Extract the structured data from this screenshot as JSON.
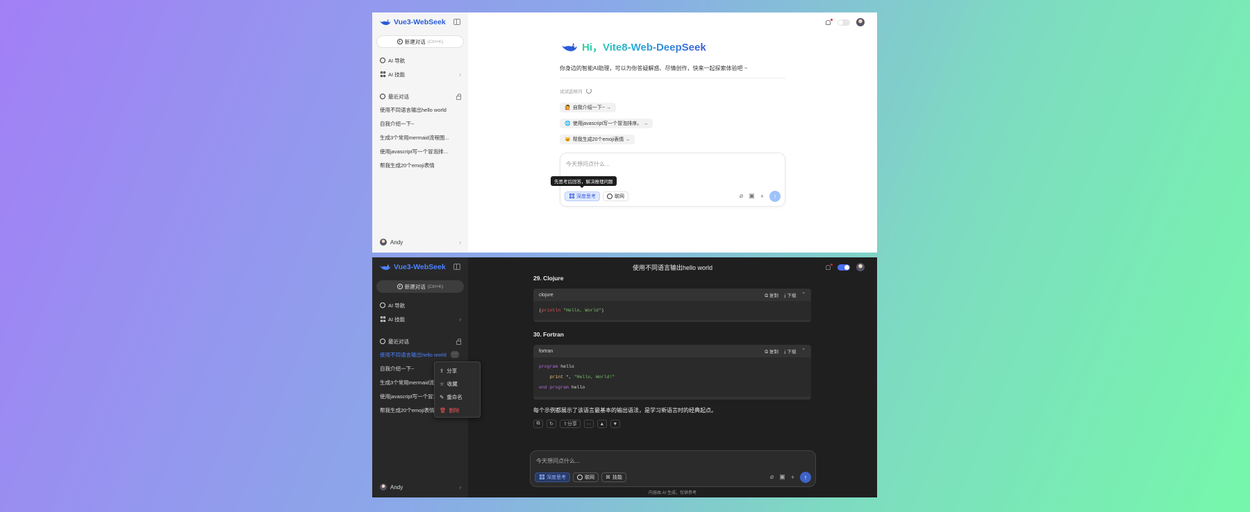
{
  "app": {
    "name": "Vue3-WebSeek",
    "user": "Andy"
  },
  "colors": {
    "accent": "#4c82ff",
    "brand_blue": "#2a5bd7",
    "danger": "#ef5454",
    "send_light": "#9ec2fa",
    "send_dark": "#3e63c8"
  },
  "icons": {
    "logo": "whale-logo-icon",
    "collapse": "sidebar-toggle-icon",
    "new_chat": "plus-circle-icon",
    "ai_nav": "compass-icon",
    "ai_skills": "grid-icon",
    "recent": "chat-bubble-icon",
    "clear_history": "lock-icon",
    "notifications": "bell-icon",
    "theme": "toggle-switch-icon",
    "attach": "paperclip-icon",
    "image": "image-icon",
    "add": "plus-icon",
    "send": "arrow-up-icon"
  },
  "sidebar": {
    "new_chat": "新建对话",
    "new_chat_hint": "(Ctrl+K)",
    "ai_nav": "AI 导航",
    "ai_skills": "AI 技能",
    "recent_title": "最近对话",
    "recent": [
      "使用不同语言输出hello world",
      "自我介绍一下~",
      "生成3个常用mermaid流程图...",
      "使用javascript写一个冒泡排...",
      "帮我生成20个emoji表情"
    ],
    "recent_dark": [
      "使用不同语言输出hello world",
      "自我介绍一下~",
      "生成3个常用mermaid流程",
      "使用javascript写一个冒泡",
      "帮我生成20个emoji表情"
    ]
  },
  "light": {
    "greeting": "Hi，Vite8-Web-DeepSeek",
    "subtitle": "你身边的智能AI助理，可以为你答疑解惑、尽情创作，快来一起探索体验吧 ~",
    "try_label": "试试这样问",
    "suggestions": [
      {
        "emoji": "🙋",
        "text": "自我介绍一下~ →"
      },
      {
        "emoji": "🌐",
        "text": "使用javascript写一个冒泡排序。 →"
      },
      {
        "emoji": "🐱",
        "text": "帮我生成20个emoji表情 →"
      }
    ],
    "placeholder": "今天想问点什么...",
    "tooltip": "先思考后回答，解决推理问题",
    "deep_think": "深度思考",
    "web": "联网"
  },
  "dark": {
    "chat_title": "使用不同语言输出hello world",
    "sections": [
      {
        "title": "29. Clojure",
        "lang": "clojure"
      },
      {
        "title": "30. Fortran",
        "lang": "fortran"
      }
    ],
    "copy": "复制",
    "download": "下载",
    "code_clojure": {
      "open": "(",
      "fn": "println",
      "str": " \"Hello, World\"",
      "close": ")"
    },
    "code_fortran": {
      "kw1": "program",
      "name1": " hello",
      "kw2": "print",
      "mid": " *, ",
      "str": "\"Hello, World!\"",
      "kw3": "end program",
      "name3": " hello"
    },
    "summary": "每个示例都展示了该语言最基本的输出语法，是学习新语言时的经典起点。",
    "share": "分享",
    "placeholder": "今天想问点什么...",
    "deep_think": "深度思考",
    "web": "联网",
    "skills": "技能",
    "footer": "内容由 AI 生成，仅供参考",
    "context_menu": [
      "分享",
      "收藏",
      "重命名",
      "删除"
    ]
  }
}
